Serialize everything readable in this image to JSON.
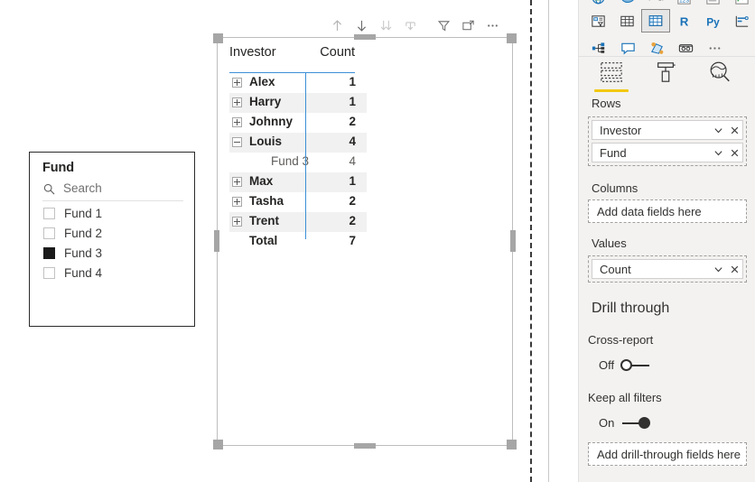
{
  "slicer": {
    "title": "Fund",
    "search_placeholder": "Search",
    "items": [
      {
        "label": "Fund 1",
        "checked": false
      },
      {
        "label": "Fund 2",
        "checked": false
      },
      {
        "label": "Fund 3",
        "checked": true
      },
      {
        "label": "Fund 4",
        "checked": false
      }
    ]
  },
  "visual_toolbar": {
    "buttons": [
      {
        "name": "drill-up-icon",
        "title": "Drill up"
      },
      {
        "name": "drill-down-icon",
        "title": "Drill down"
      },
      {
        "name": "expand-all-icon",
        "title": "Expand all down one level in the hierarchy"
      },
      {
        "name": "go-to-next-level-icon",
        "title": "Go to the next level in the hierarchy"
      },
      {
        "name": "filter-icon",
        "title": "Filters"
      },
      {
        "name": "focus-mode-icon",
        "title": "Focus mode"
      },
      {
        "name": "more-options-icon",
        "title": "More options"
      }
    ]
  },
  "matrix": {
    "columns": [
      "Investor",
      "Count"
    ],
    "rows": [
      {
        "label": "Alex",
        "value": "1",
        "expand": "plus",
        "level": 0,
        "band": false
      },
      {
        "label": "Harry",
        "value": "1",
        "expand": "plus",
        "level": 0,
        "band": true
      },
      {
        "label": "Johnny",
        "value": "2",
        "expand": "plus",
        "level": 0,
        "band": false
      },
      {
        "label": "Louis",
        "value": "4",
        "expand": "minus",
        "level": 0,
        "band": true
      },
      {
        "label": "Fund 3",
        "value": "4",
        "expand": "none",
        "level": 1,
        "band": false
      },
      {
        "label": "Max",
        "value": "1",
        "expand": "plus",
        "level": 0,
        "band": true
      },
      {
        "label": "Tasha",
        "value": "2",
        "expand": "plus",
        "level": 0,
        "band": false
      },
      {
        "label": "Trent",
        "value": "2",
        "expand": "plus",
        "level": 0,
        "band": true
      },
      {
        "label": "Total",
        "value": "7",
        "expand": "none",
        "level": 0,
        "band": false
      }
    ]
  },
  "right_pane": {
    "gallery": {
      "rows": [
        [
          {
            "name": "map-icon"
          },
          {
            "name": "filled-map-icon"
          },
          {
            "name": "arcgis-map-icon"
          },
          {
            "name": "card-icon"
          },
          {
            "name": "multi-row-card-icon"
          },
          {
            "name": "kpi-icon"
          }
        ],
        [
          {
            "name": "slicer-icon"
          },
          {
            "name": "table-icon"
          },
          {
            "name": "matrix-icon",
            "selected": true
          },
          {
            "name": "r-script-visual-icon"
          },
          {
            "name": "python-visual-icon"
          },
          {
            "name": "key-influencers-icon"
          }
        ],
        [
          {
            "name": "decomposition-tree-icon"
          },
          {
            "name": "qna-icon"
          },
          {
            "name": "smart-narrative-icon"
          },
          {
            "name": "paginated-report-icon"
          },
          {
            "name": "get-more-visuals-icon"
          }
        ]
      ]
    },
    "tabs": [
      {
        "name": "tab-fields",
        "icon": "fields-icon",
        "active": true
      },
      {
        "name": "tab-format",
        "icon": "paint-roller-icon",
        "active": false
      },
      {
        "name": "tab-analytics",
        "icon": "analytics-magnifier-icon",
        "active": false
      }
    ],
    "wells": {
      "rows_label": "Rows",
      "rows_fields": [
        "Investor",
        "Fund"
      ],
      "columns_label": "Columns",
      "columns_placeholder": "Add data fields here",
      "values_label": "Values",
      "values_fields": [
        "Count"
      ]
    },
    "drill_through": {
      "title": "Drill through",
      "cross_report_label": "Cross-report",
      "cross_report_state": "Off",
      "cross_report_on": false,
      "keep_filters_label": "Keep all filters",
      "keep_filters_state": "On",
      "keep_filters_on": true,
      "add_fields_placeholder": "Add drill-through fields here"
    }
  },
  "colors": {
    "accent_yellow": "#f2c811",
    "matrix_rule_blue": "#3c8fd6",
    "row_band": "#f1f1f1",
    "pane_bg": "#f3f2f1",
    "viz_icon_blue": "#1a72b8"
  }
}
